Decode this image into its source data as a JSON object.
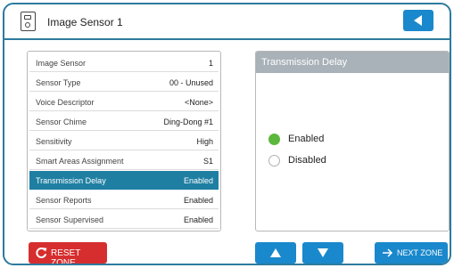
{
  "header": {
    "title": "Image Sensor 1",
    "sensor_icon": "image-sensor-icon",
    "back_icon": "back-arrow-icon"
  },
  "sensor_list": {
    "selected_index": 6,
    "items": [
      {
        "label": "Image Sensor",
        "value": "1"
      },
      {
        "label": "Sensor Type",
        "value": "00 - Unused"
      },
      {
        "label": "Voice Descriptor",
        "value": "<None>"
      },
      {
        "label": "Sensor Chime",
        "value": "Ding-Dong #1"
      },
      {
        "label": "Sensitivity",
        "value": "High"
      },
      {
        "label": "Smart Areas Assignment",
        "value": "S1"
      },
      {
        "label": "Transmission Delay",
        "value": "Enabled"
      },
      {
        "label": "Sensor Reports",
        "value": "Enabled"
      },
      {
        "label": "Sensor Supervised",
        "value": "Enabled"
      }
    ]
  },
  "detail": {
    "title": "Transmission Delay",
    "options": [
      {
        "label": "Enabled",
        "selected": true
      },
      {
        "label": "Disabled",
        "selected": false
      }
    ]
  },
  "footer": {
    "reset_label": "RESET ZONE",
    "reset_icon": "refresh-icon",
    "up_icon": "arrow-up-icon",
    "down_icon": "arrow-down-icon",
    "next_label": "NEXT ZONE",
    "next_icon": "arrow-right-icon"
  },
  "colors": {
    "accent_blue": "#1a88cc",
    "selected_row": "#1f7fa3",
    "reset_red": "#d62e2e",
    "radio_on": "#5cb83c",
    "frame": "#2d7a9e"
  }
}
